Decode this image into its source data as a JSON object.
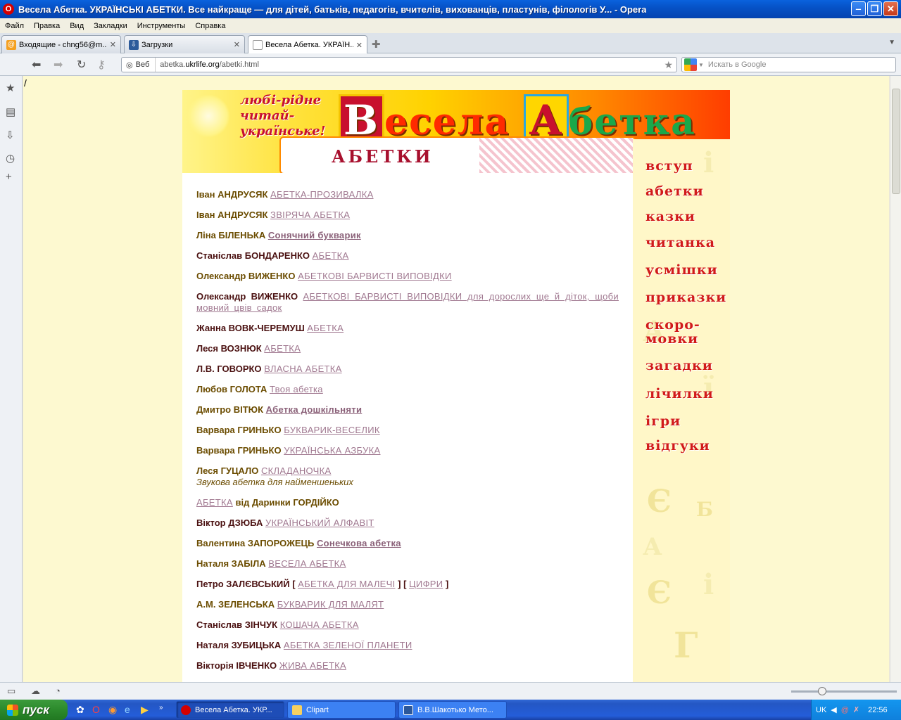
{
  "window": {
    "title": "Весела Абетка. УКРАЇНСЬКІ АБЕТКИ. Все найкраще — для дітей, батьків, педагогів, вчителів, вихованців, пластунів, філологів У... - Opera"
  },
  "menu": [
    "Файл",
    "Правка",
    "Вид",
    "Закладки",
    "Инструменты",
    "Справка"
  ],
  "tabs": [
    {
      "label": "Входящие - chng56@m...",
      "icon": "mail-icon"
    },
    {
      "label": "Загрузки",
      "icon": "download-icon"
    },
    {
      "label": "Весела Абетка. УКРАЇН...",
      "icon": "page-icon",
      "active": true
    }
  ],
  "address": {
    "chip": "Веб",
    "url_prefix": "abetka.",
    "url_domain": "ukrlife.org",
    "url_path": "/abetki.html"
  },
  "search": {
    "placeholder": "Искать в Google"
  },
  "page": {
    "slash": "/",
    "slogan": [
      "любі-рідне",
      "читай-",
      "українське!"
    ],
    "site_title": {
      "big1": "В",
      "rest1": "есела",
      "big2": "А",
      "rest2": "бетка"
    },
    "section_title": "АБЕТКИ",
    "entries": [
      {
        "author": "Іван АНДРУСЯК",
        "link": "АБЕТКА-ПРОЗИВАЛКА",
        "tone": "gold"
      },
      {
        "author": "Іван АНДРУСЯК",
        "link": "ЗВІРЯЧА АБЕТКА",
        "tone": "gold"
      },
      {
        "author": "Ліна БІЛЕНЬКА",
        "link": "Сонячний букварик",
        "tone": "gold",
        "strong": true
      },
      {
        "author": "Станіслав БОНДАРЕНКО",
        "link": "АБЕТКА",
        "tone": "dark"
      },
      {
        "author": "Олександр ВИЖЕНКО",
        "link": "АБЕТКОВІ БАРВИСТІ ВИПОВІДКИ",
        "tone": "gold"
      },
      {
        "author": "Олександр ВИЖЕНКО",
        "link": "АБЕТКОВІ БАРВИСТІ ВИПОВІДКИ для дорослих ще й діток, щоби мовний цвів садок",
        "tone": "dark"
      },
      {
        "author": "Жанна ВОВК-ЧЕРЕМУШ",
        "link": "АБЕТКА",
        "tone": "dark"
      },
      {
        "author": "Леся ВОЗНЮК",
        "link": "АБЕТКА",
        "tone": "dark"
      },
      {
        "author": "Л.В. ГОВОРКО",
        "link": "ВЛАСНА АБЕТКА",
        "tone": "dark"
      },
      {
        "author": "Любов ГОЛОТА",
        "link": "Твоя абетка",
        "tone": "gold"
      },
      {
        "author": "Дмитро ВІТЮК",
        "link": "Абетка дошкільняти",
        "tone": "gold",
        "strong": true
      },
      {
        "author": "Варвара ГРИНЬКО",
        "link": "БУКВАРИК-ВЕСЕЛИК",
        "tone": "gold"
      },
      {
        "author": "Варвара ГРИНЬКО",
        "link": "УКРАЇНСЬКА АЗБУКА",
        "tone": "gold"
      },
      {
        "author": "Леся ГУЦАЛО",
        "link": "СКЛАДАНОЧКА",
        "sub": "Звукова абетка для найменшеньких",
        "tone": "gold"
      },
      {
        "author": "від Даринки ГОРДІЙКО",
        "link": "АБЕТКА",
        "tone": "gold",
        "link_first": true
      },
      {
        "author": "Віктор ДЗЮБА",
        "link": "УКРАЇНСЬКИЙ АЛФАВІТ",
        "tone": "dark"
      },
      {
        "author": "Валентина ЗАПОРОЖЕЦЬ",
        "link": "Сонечкова абетка",
        "tone": "gold",
        "strong": true
      },
      {
        "author": "Наталя ЗАБІЛА",
        "link": "ВЕСЕЛА АБЕТКА",
        "tone": "gold"
      },
      {
        "author": "Петро ЗАЛЄВСЬКИЙ",
        "link": "АБЕТКА ДЛЯ МАЛЕЧІ",
        "link2": "ЦИФРИ",
        "tone": "dark"
      },
      {
        "author": "А.М. ЗЕЛЕНСЬКА",
        "link": "БУКВАРИК ДЛЯ МАЛЯТ",
        "tone": "gold"
      },
      {
        "author": "Станіслав ЗІНЧУК",
        "link": "КОШАЧА АБЕТКА",
        "tone": "dark"
      },
      {
        "author": "Наталя ЗУБИЦЬКА",
        "link": "АБЕТКА ЗЕЛЕНОЇ ПЛАНЕТИ",
        "tone": "dark"
      },
      {
        "author": "Вікторія ІВЧЕНКО",
        "link": "ЖИВА АБЕТКА",
        "tone": "dark"
      }
    ],
    "nav": [
      {
        "label": "вступ"
      },
      {
        "label": "абетки"
      },
      {
        "label": "казки"
      },
      {
        "label": "читанка"
      },
      {
        "label": "усмішки"
      },
      {
        "label": "приказки"
      },
      {
        "label": "скоро-",
        "label2": "мовки"
      },
      {
        "label": "загадки"
      },
      {
        "label": "лічилки"
      },
      {
        "label": "ігри"
      },
      {
        "label": "відгуки"
      }
    ]
  },
  "taskbar": {
    "start": "пуск",
    "tasks": [
      {
        "label": "Весела Абетка. УКР...",
        "active": true
      },
      {
        "label": "Clipart"
      },
      {
        "label": "В.В.Шакотько Мето..."
      }
    ],
    "lang": "UK",
    "clock": "22:56"
  },
  "colors": {
    "accent_red": "#d11a1a",
    "titlebar_blue": "#0652c7",
    "start_green": "#2c8a2c"
  }
}
